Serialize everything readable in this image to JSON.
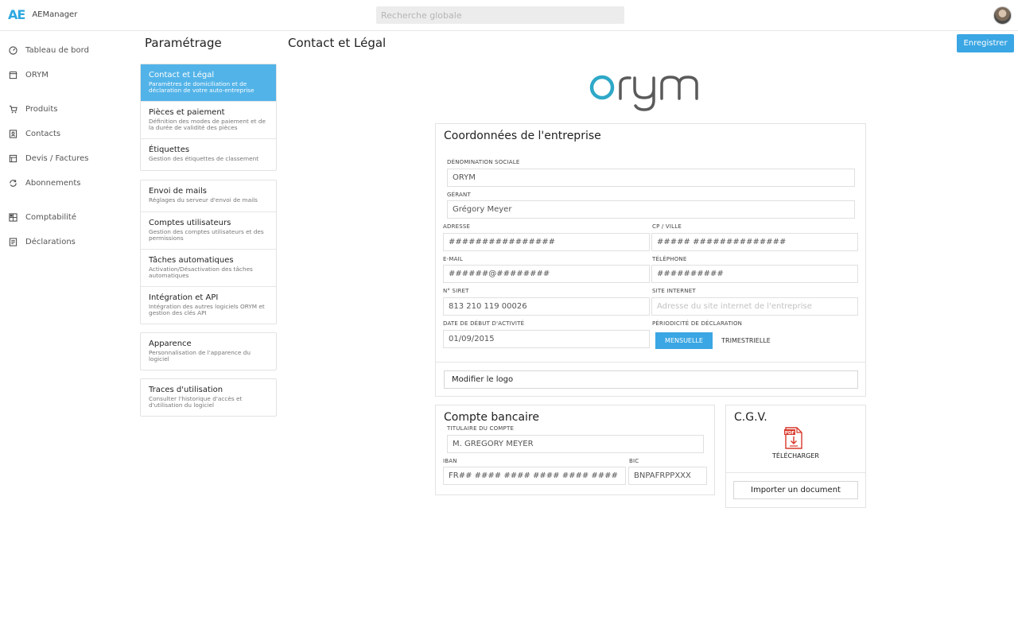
{
  "app": {
    "logo": "AE",
    "name": "AEManager"
  },
  "search": {
    "placeholder": "Recherche globale"
  },
  "sidebar": {
    "items": [
      {
        "label": "Tableau de bord",
        "icon": "dashboard-icon"
      },
      {
        "label": "ORYM",
        "icon": "store-icon"
      },
      {
        "label": "Produits",
        "icon": "cart-icon"
      },
      {
        "label": "Contacts",
        "icon": "contact-icon"
      },
      {
        "label": "Devis / Factures",
        "icon": "invoice-icon"
      },
      {
        "label": "Abonnements",
        "icon": "refresh-icon"
      },
      {
        "label": "Comptabilité",
        "icon": "accounting-icon"
      },
      {
        "label": "Déclarations",
        "icon": "declaration-icon"
      }
    ]
  },
  "settings": {
    "title": "Paramétrage",
    "groups": [
      [
        {
          "title": "Contact et Légal",
          "desc": "Paramètres de domiciliation et de déclaration de votre auto-entreprise",
          "active": true
        },
        {
          "title": "Pièces et paiement",
          "desc": "Définition des modes de paiement et de la durée de validité des pièces"
        },
        {
          "title": "Étiquettes",
          "desc": "Gestion des étiquettes de classement"
        }
      ],
      [
        {
          "title": "Envoi de mails",
          "desc": "Réglages du serveur d'envoi de mails"
        },
        {
          "title": "Comptes utilisateurs",
          "desc": "Gestion des comptes utilisateurs et des permissions"
        },
        {
          "title": "Tâches automatiques",
          "desc": "Activation/Désactivation des tâches automatiques"
        },
        {
          "title": "Intégration et API",
          "desc": "Intégration des autres logiciels ORYM et gestion des clés API"
        }
      ],
      [
        {
          "title": "Apparence",
          "desc": "Personnalisation de l'apparence du logiciel"
        }
      ],
      [
        {
          "title": "Traces d'utilisation",
          "desc": "Consulter l'historique d'accès et d'utilisation du logiciel"
        }
      ]
    ]
  },
  "content": {
    "title": "Contact et Légal",
    "save_label": "Enregistrer",
    "brand_logo": "orym"
  },
  "company": {
    "title": "Coordonnées de l'entreprise",
    "denomination_label": "DÉNOMINATION SOCIALE",
    "denomination": "ORYM",
    "manager_label": "GÉRANT",
    "manager": "Grégory Meyer",
    "address_label": "ADRESSE",
    "address": "################",
    "city_label": "CP / VILLE",
    "city": "##### ##############",
    "email_label": "E-MAIL",
    "email": "######@########",
    "phone_label": "TÉLÉPHONE",
    "phone": "##########",
    "siret_label": "N° SIRET",
    "siret": "813 210 119 00026",
    "website_label": "SITE INTERNET",
    "website_placeholder": "Adresse du site internet de l'entreprise",
    "start_label": "DATE DE DÉBUT D'ACTIVITÉ",
    "start": "01/09/2015",
    "period_label": "PÉRIODICITÉ DE DÉCLARATION",
    "period_monthly": "MENSUELLE",
    "period_quarterly": "TRIMESTRIELLE",
    "logo_button": "Modifier le logo"
  },
  "bank": {
    "title": "Compte bancaire",
    "holder_label": "TITULAIRE DU COMPTE",
    "holder": "M. GREGORY MEYER",
    "iban_label": "IBAN",
    "iban": "FR## #### #### #### #### #### ###",
    "bic_label": "BIC",
    "bic": "BNPAFRPPXXX"
  },
  "cgv": {
    "title": "C.G.V.",
    "pdf_badge": "PDF",
    "download_label": "TÉLÉCHARGER",
    "import_button": "Importer un document"
  }
}
